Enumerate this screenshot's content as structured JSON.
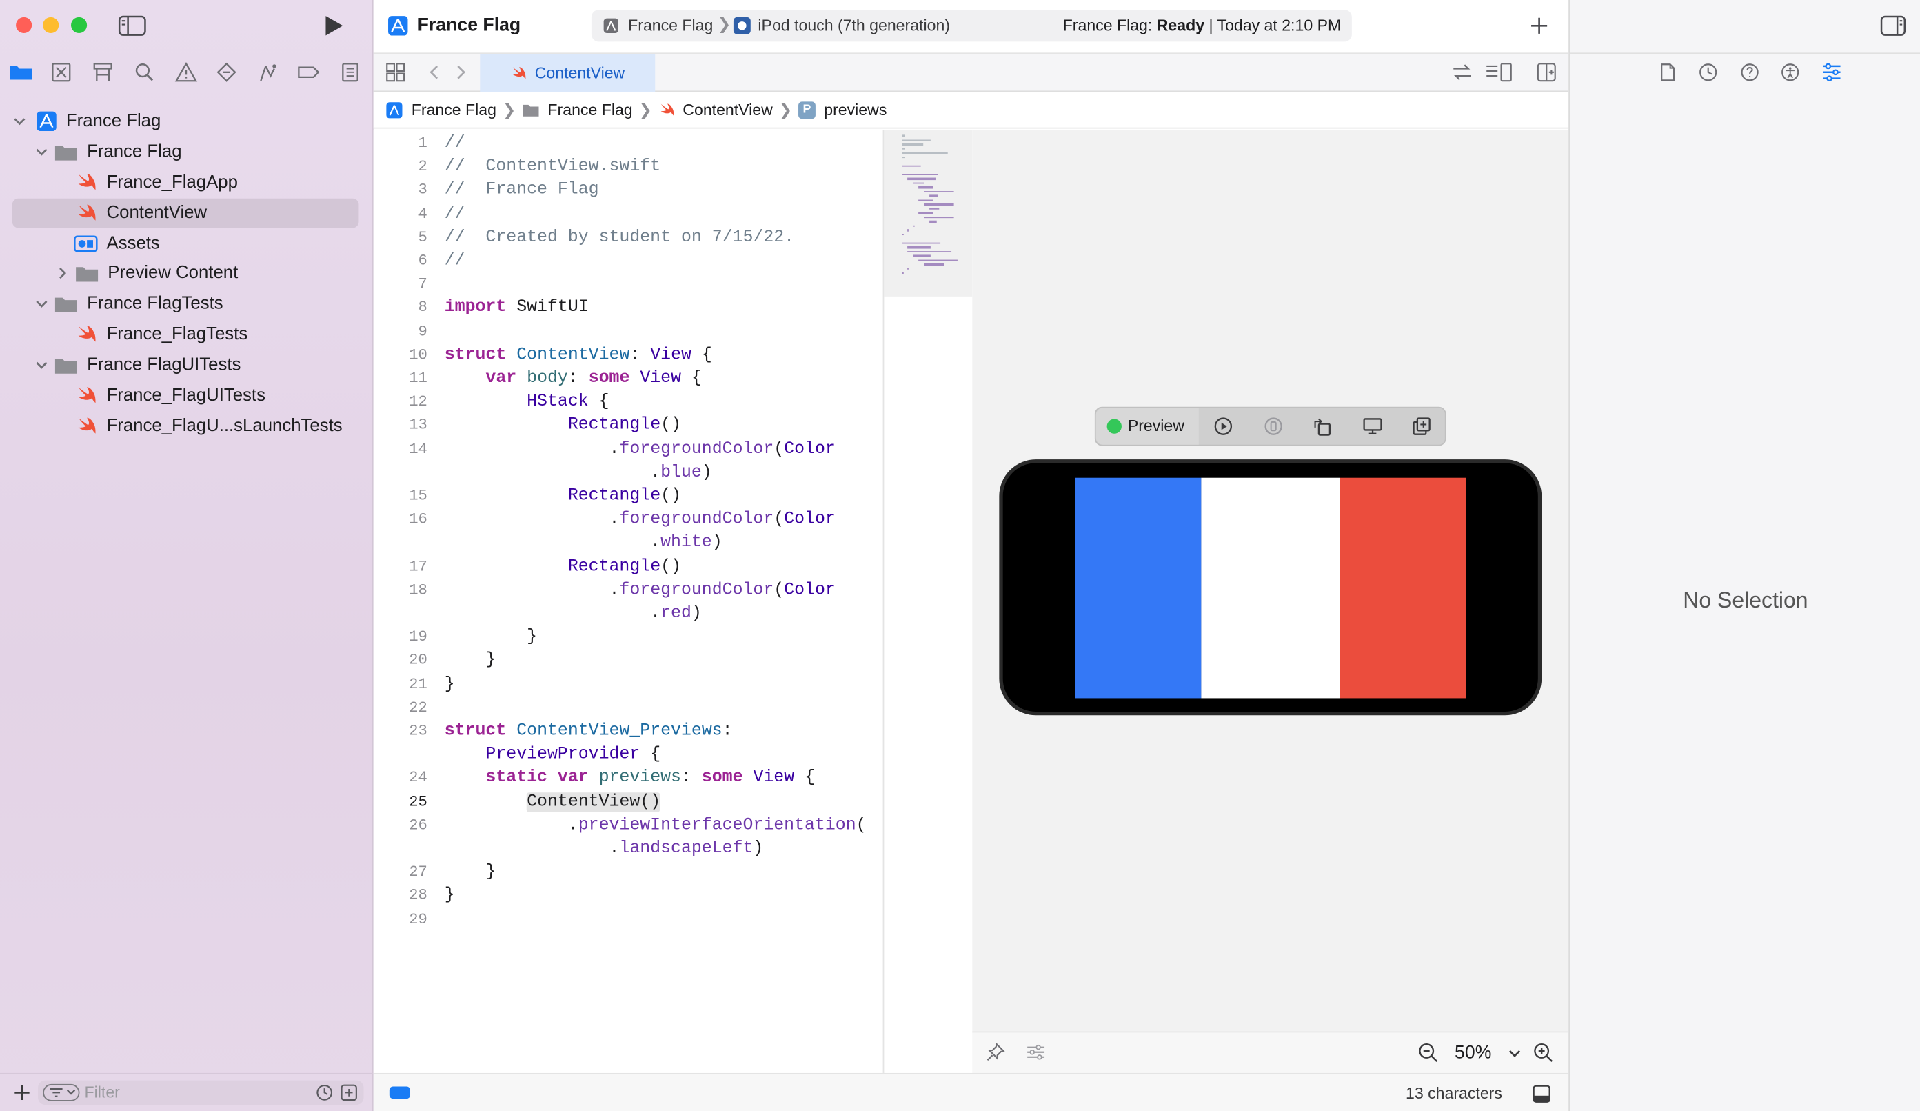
{
  "project": {
    "title": "France Flag"
  },
  "scheme": {
    "name": "France Flag",
    "device": "iPod touch (7th generation)"
  },
  "status": {
    "label": "France Flag:",
    "state": "Ready",
    "time": "| Today at 2:10 PM"
  },
  "tab": {
    "active": "ContentView"
  },
  "breadcrumb": [
    "France Flag",
    "France Flag",
    "ContentView",
    "previews"
  ],
  "navigator": {
    "items": [
      {
        "label": "France Flag",
        "kind": "project"
      },
      {
        "label": "France Flag",
        "kind": "folder"
      },
      {
        "label": "France_FlagApp",
        "kind": "swift"
      },
      {
        "label": "ContentView",
        "kind": "swift",
        "selected": true
      },
      {
        "label": "Assets",
        "kind": "assets"
      },
      {
        "label": "Preview Content",
        "kind": "folder"
      },
      {
        "label": "France FlagTests",
        "kind": "folder"
      },
      {
        "label": "France_FlagTests",
        "kind": "swift"
      },
      {
        "label": "France FlagUITests",
        "kind": "folder"
      },
      {
        "label": "France_FlagUITests",
        "kind": "swift"
      },
      {
        "label": "France_FlagU...sLaunchTests",
        "kind": "swift"
      }
    ],
    "filter_placeholder": "Filter"
  },
  "line_numbers": [
    "1",
    "2",
    "3",
    "4",
    "5",
    "6",
    "7",
    "8",
    "9",
    "10",
    "11",
    "12",
    "13",
    "14",
    "15",
    "16",
    "17",
    "18",
    "19",
    "20",
    "21",
    "22",
    "23",
    "24",
    "25",
    "26",
    "27",
    "28",
    "29"
  ],
  "current_line": "25",
  "code": [
    {
      "n": "1",
      "segs": [
        [
          "cm",
          "//"
        ]
      ]
    },
    {
      "n": "2",
      "segs": [
        [
          "cm",
          "//  ContentView.swift"
        ]
      ]
    },
    {
      "n": "3",
      "segs": [
        [
          "cm",
          "//  France Flag"
        ]
      ]
    },
    {
      "n": "4",
      "segs": [
        [
          "cm",
          "//"
        ]
      ]
    },
    {
      "n": "5",
      "segs": [
        [
          "cm",
          "//  Created by student on 7/15/22."
        ]
      ]
    },
    {
      "n": "6",
      "segs": [
        [
          "cm",
          "//"
        ]
      ]
    },
    {
      "n": "7",
      "segs": []
    },
    {
      "n": "8",
      "segs": [
        [
          "kw",
          "import"
        ],
        [
          "",
          " SwiftUI"
        ]
      ]
    },
    {
      "n": "9",
      "segs": []
    },
    {
      "n": "10",
      "segs": [
        [
          "kw",
          "struct"
        ],
        [
          "",
          " "
        ],
        [
          "ty",
          "ContentView"
        ],
        [
          "",
          ": "
        ],
        [
          "tyb",
          "View"
        ],
        [
          "",
          " {"
        ]
      ]
    },
    {
      "n": "11",
      "segs": [
        [
          "",
          "    "
        ],
        [
          "kw",
          "var"
        ],
        [
          "",
          " "
        ],
        [
          "fn",
          "body"
        ],
        [
          "",
          ": "
        ],
        [
          "kw",
          "some"
        ],
        [
          "",
          " "
        ],
        [
          "tyb",
          "View"
        ],
        [
          "",
          " {"
        ]
      ]
    },
    {
      "n": "12",
      "segs": [
        [
          "",
          "        "
        ],
        [
          "tyb",
          "HStack"
        ],
        [
          "",
          " {"
        ]
      ]
    },
    {
      "n": "13",
      "segs": [
        [
          "",
          "            "
        ],
        [
          "tyb",
          "Rectangle"
        ],
        [
          "",
          "()"
        ]
      ]
    },
    {
      "n": "14",
      "segs": [
        [
          "",
          "                ."
        ],
        [
          "mb",
          "foregroundColor"
        ],
        [
          "",
          "("
        ],
        [
          "tyb",
          "Color"
        ]
      ]
    },
    {
      "n": "",
      "segs": [
        [
          "",
          "                    ."
        ],
        [
          "mb",
          "blue"
        ],
        [
          "",
          ")"
        ]
      ]
    },
    {
      "n": "15",
      "segs": [
        [
          "",
          "            "
        ],
        [
          "tyb",
          "Rectangle"
        ],
        [
          "",
          "()"
        ]
      ]
    },
    {
      "n": "16",
      "segs": [
        [
          "",
          "                ."
        ],
        [
          "mb",
          "foregroundColor"
        ],
        [
          "",
          "("
        ],
        [
          "tyb",
          "Color"
        ]
      ]
    },
    {
      "n": "",
      "segs": [
        [
          "",
          "                    ."
        ],
        [
          "mb",
          "white"
        ],
        [
          "",
          ")"
        ]
      ]
    },
    {
      "n": "17",
      "segs": [
        [
          "",
          "            "
        ],
        [
          "tyb",
          "Rectangle"
        ],
        [
          "",
          "()"
        ]
      ]
    },
    {
      "n": "18",
      "segs": [
        [
          "",
          "                ."
        ],
        [
          "mb",
          "foregroundColor"
        ],
        [
          "",
          "("
        ],
        [
          "tyb",
          "Color"
        ]
      ]
    },
    {
      "n": "",
      "segs": [
        [
          "",
          "                    ."
        ],
        [
          "mb",
          "red"
        ],
        [
          "",
          ")"
        ]
      ]
    },
    {
      "n": "19",
      "segs": [
        [
          "",
          "        }"
        ]
      ]
    },
    {
      "n": "20",
      "segs": [
        [
          "",
          "    }"
        ]
      ]
    },
    {
      "n": "21",
      "segs": [
        [
          "",
          "}"
        ]
      ]
    },
    {
      "n": "22",
      "segs": []
    },
    {
      "n": "23",
      "segs": [
        [
          "kw",
          "struct"
        ],
        [
          "",
          " "
        ],
        [
          "ty",
          "ContentView_Previews"
        ],
        [
          "",
          ":"
        ]
      ]
    },
    {
      "n": "",
      "segs": [
        [
          "",
          "    "
        ],
        [
          "tyb",
          "PreviewProvider"
        ],
        [
          "",
          " {"
        ]
      ]
    },
    {
      "n": "24",
      "segs": [
        [
          "",
          "    "
        ],
        [
          "kw",
          "static var"
        ],
        [
          "",
          " "
        ],
        [
          "fn",
          "previews"
        ],
        [
          "",
          ": "
        ],
        [
          "kw",
          "some"
        ],
        [
          "",
          " "
        ],
        [
          "tyb",
          "View"
        ],
        [
          "",
          " {"
        ]
      ]
    },
    {
      "n": "25",
      "segs": [
        [
          "",
          "        "
        ],
        [
          "hl",
          "ContentView()"
        ]
      ]
    },
    {
      "n": "26",
      "segs": [
        [
          "",
          "            ."
        ],
        [
          "mb",
          "previewInterfaceOrientation"
        ],
        [
          "",
          "("
        ]
      ]
    },
    {
      "n": "",
      "segs": [
        [
          "",
          "                ."
        ],
        [
          "mb",
          "landscapeLeft"
        ],
        [
          "",
          ")"
        ]
      ]
    },
    {
      "n": "27",
      "segs": [
        [
          "",
          "    }"
        ]
      ]
    },
    {
      "n": "28",
      "segs": [
        [
          "",
          "}"
        ]
      ]
    },
    {
      "n": "29",
      "segs": []
    }
  ],
  "preview": {
    "label": "Preview",
    "flag_colors": [
      "#3478f6",
      "#ffffff",
      "#eb4d3d"
    ],
    "zoom": "50%"
  },
  "editor_status": {
    "selection": "13 characters"
  },
  "inspector": {
    "empty_text": "No Selection"
  },
  "colors": {
    "accent": "#007aff",
    "sidebar_selection": "#d3c6d6"
  }
}
